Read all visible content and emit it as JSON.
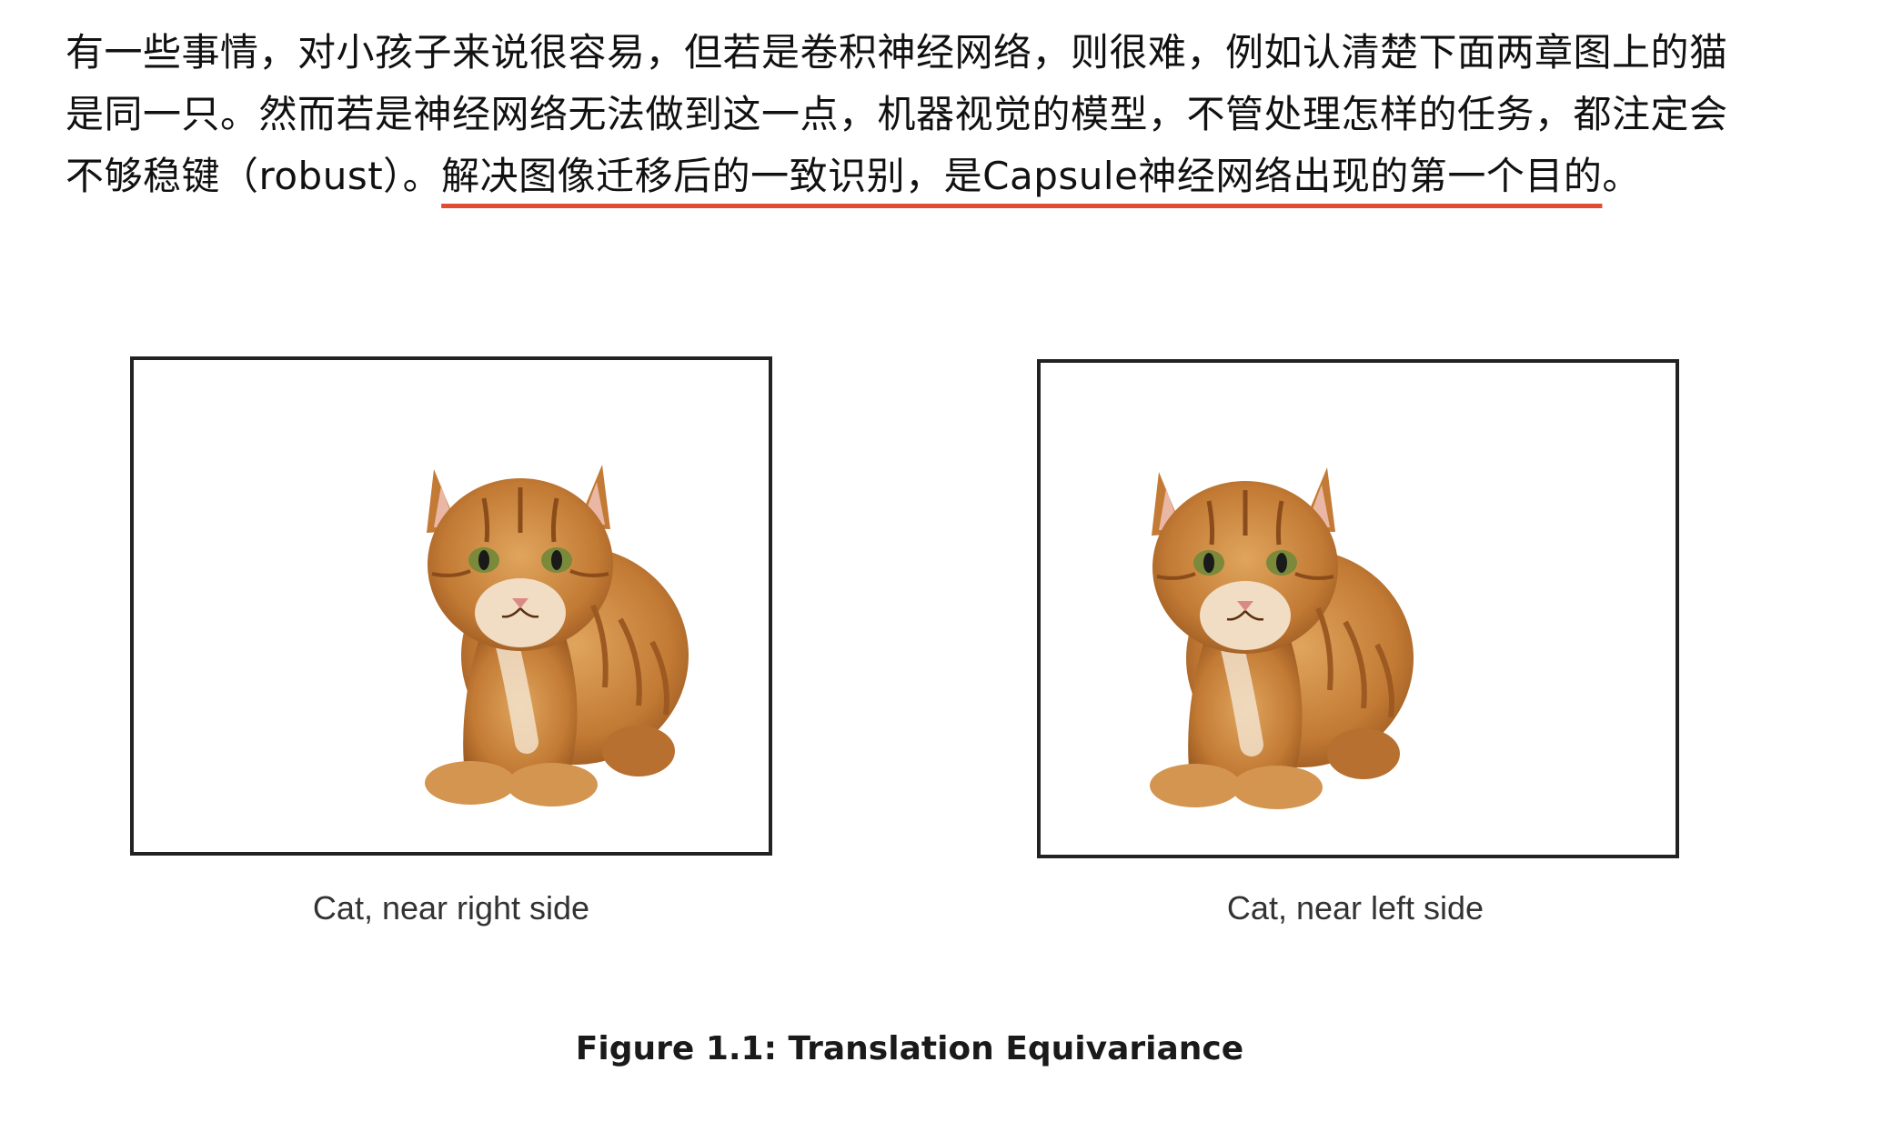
{
  "paragraph": {
    "line1": "有一些事情，对小孩子来说很容易，但若是卷积神经网络，则很难，例如认清楚下面两章图上的猫",
    "line2": "是同一只。然而若是神经网络无法做到这一点，机器视觉的模型，不管处理怎样的任务，都注定会",
    "line3_start": "不够稳键（robust）。",
    "line3_highlight": "解决图像迁移后的一致识别，是Capsule神经网络出现的第一个目的",
    "line3_end": "。"
  },
  "figure": {
    "left_caption": "Cat, near right side",
    "right_caption": "Cat, near left side",
    "title": "Figure 1.1: Translation Equivariance"
  },
  "colors": {
    "underline": "#e14b33",
    "cat_fur": "#c9853a",
    "frame_border": "#222222"
  }
}
